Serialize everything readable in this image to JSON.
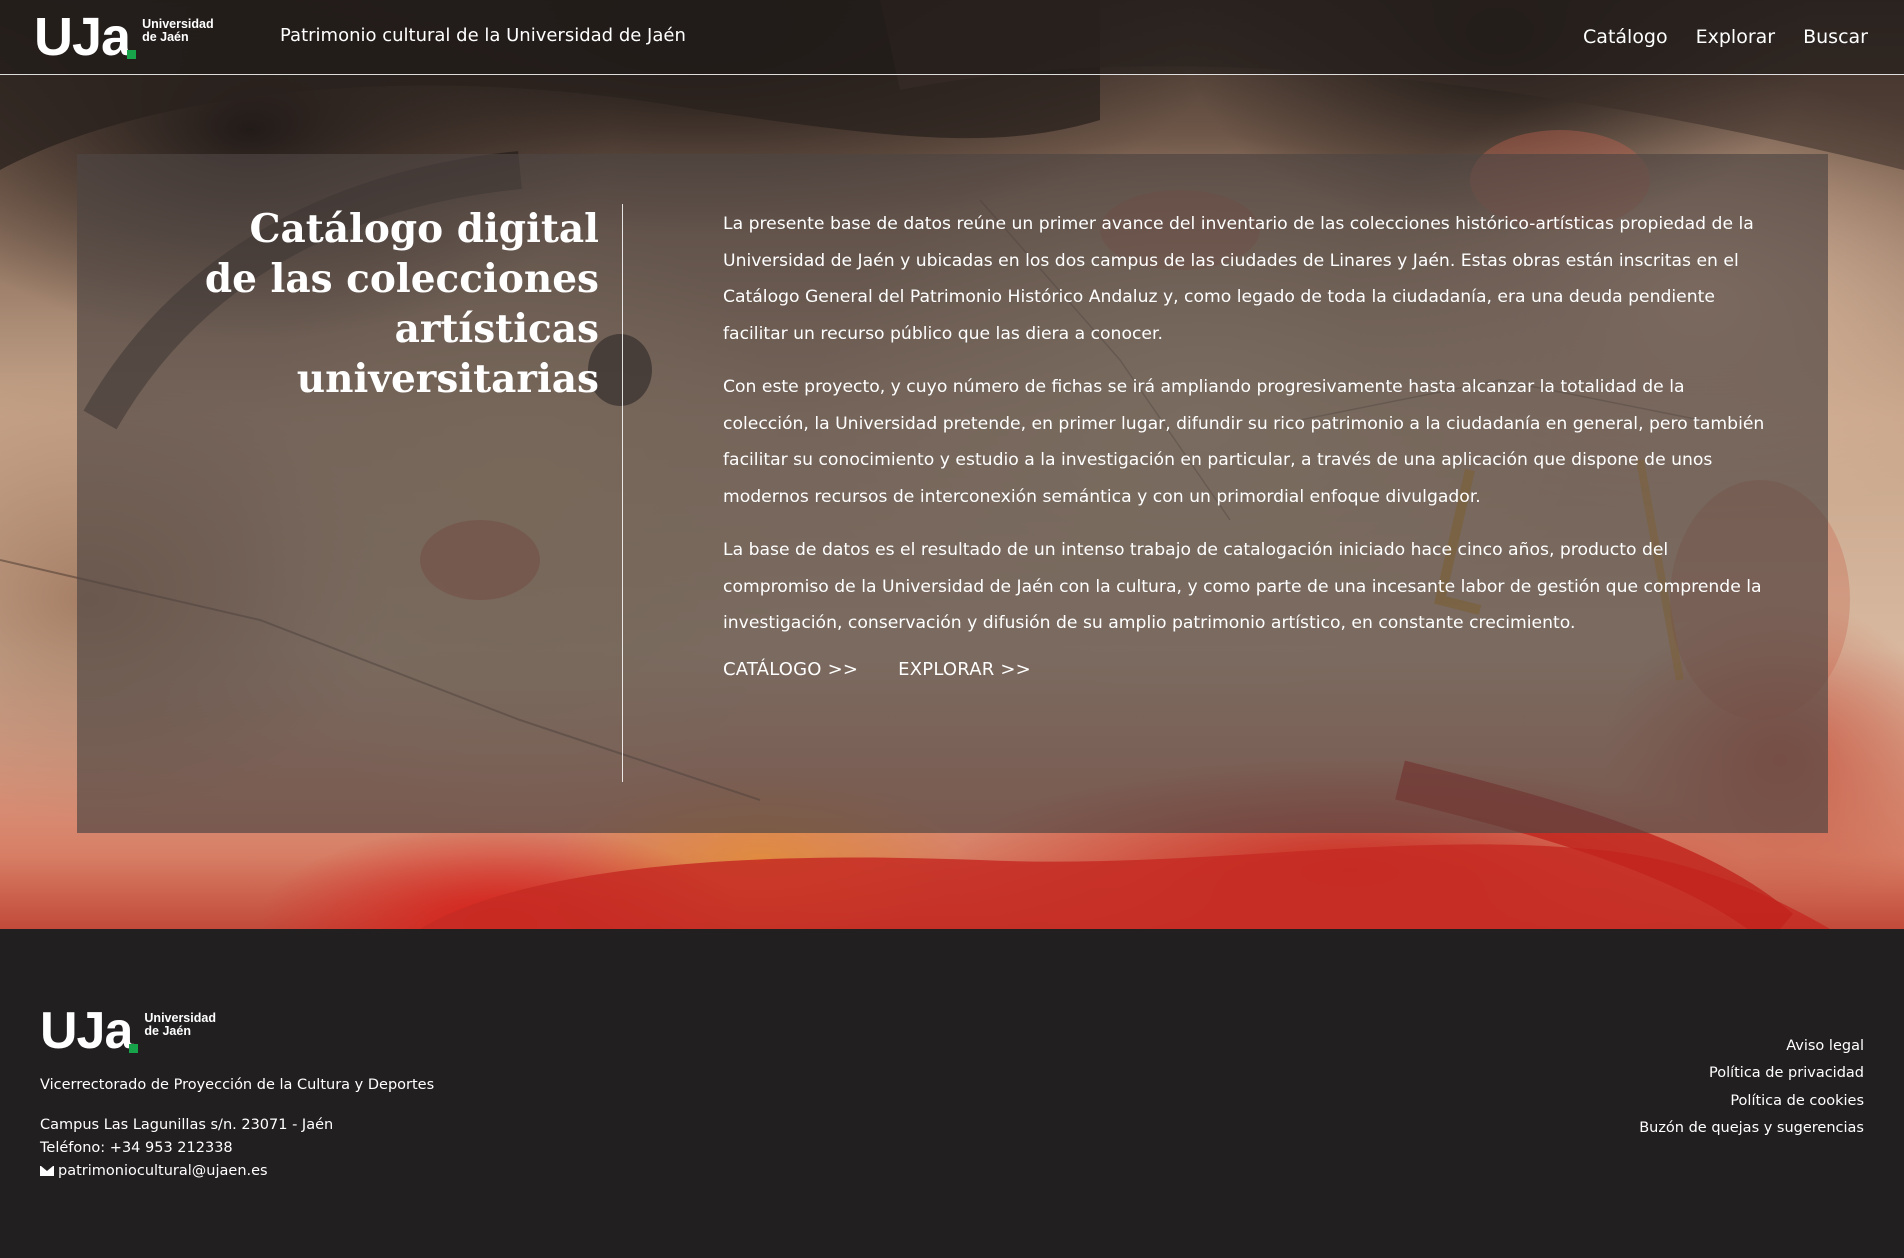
{
  "header": {
    "logo": {
      "main": "UJa",
      "line1": "Universidad",
      "line2": "de Jaén"
    },
    "site_title": "Patrimonio cultural de la Universidad de Jaén",
    "nav": [
      {
        "label": "Catálogo"
      },
      {
        "label": "Explorar"
      },
      {
        "label": "Buscar"
      }
    ]
  },
  "hero": {
    "title_lines": [
      "Catálogo digital",
      "de las colecciones",
      "artísticas",
      "universitarias"
    ],
    "paragraphs": [
      "La presente base de datos reúne un primer avance del inventario de las colecciones histórico-artísticas propiedad de la Universidad de Jaén y ubicadas en los dos campus de las ciudades de Linares y Jaén. Estas obras están inscritas en el Catálogo General del Patrimonio Histórico Andaluz y, como legado de toda la ciudadanía, era una deuda pendiente facilitar un recurso público que las diera a conocer.",
      "Con este proyecto, y cuyo número de fichas se irá ampliando progresivamente hasta alcanzar la totalidad de la colección, la Universidad pretende, en primer lugar, difundir su rico patrimonio a la ciudadanía en general, pero también facilitar su conocimiento y estudio a la investigación en particular, a través de una aplicación que dispone de unos modernos recursos de interconexión semántica y con un primordial enfoque divulgador.",
      "La base de datos es el resultado de un intenso trabajo de catalogación iniciado hace cinco años, producto del compromiso de la Universidad de Jaén con la cultura, y como parte de una incesante labor de gestión que comprende la investigación, conservación y difusión de su amplio patrimonio artístico, en constante crecimiento."
    ],
    "links": {
      "catalog": "CATÁLOGO >>",
      "explore": "EXPLORAR >>"
    }
  },
  "footer": {
    "logo": {
      "main": "UJa",
      "line1": "Universidad",
      "line2": "de Jaén"
    },
    "office": "Vicerrectorado de Proyección de la Cultura y Deportes",
    "address": "Campus Las Lagunillas s/n. 23071 - Jaén",
    "phone": "Teléfono: +34 953 212338",
    "email": "patrimoniocultural@ujaen.es",
    "email_icon": "envelope-icon",
    "links": [
      {
        "label": "Aviso legal"
      },
      {
        "label": "Política de privacidad"
      },
      {
        "label": "Política de cookies"
      },
      {
        "label": "Buzón de quejas y sugerencias"
      }
    ]
  },
  "colors": {
    "brand_green": "#16a34a",
    "footer_bg": "#221f20",
    "panel_overlay": "rgba(78,70,66,0.68)"
  }
}
